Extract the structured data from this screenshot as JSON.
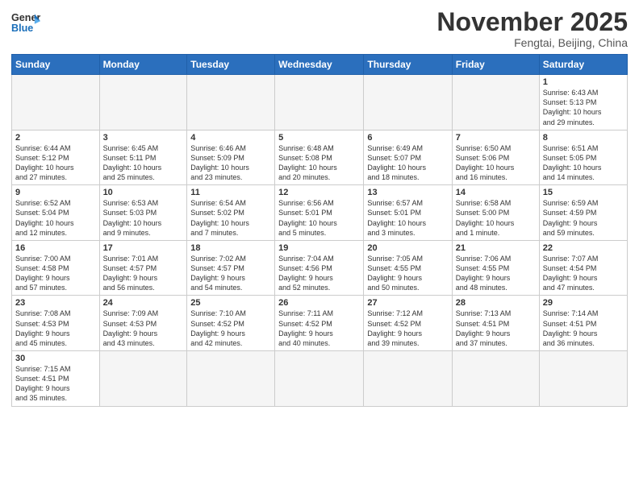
{
  "header": {
    "logo_general": "General",
    "logo_blue": "Blue",
    "month": "November 2025",
    "location": "Fengtai, Beijing, China"
  },
  "days_of_week": [
    "Sunday",
    "Monday",
    "Tuesday",
    "Wednesday",
    "Thursday",
    "Friday",
    "Saturday"
  ],
  "weeks": [
    [
      {
        "num": "",
        "info": ""
      },
      {
        "num": "",
        "info": ""
      },
      {
        "num": "",
        "info": ""
      },
      {
        "num": "",
        "info": ""
      },
      {
        "num": "",
        "info": ""
      },
      {
        "num": "",
        "info": ""
      },
      {
        "num": "1",
        "info": "Sunrise: 6:43 AM\nSunset: 5:13 PM\nDaylight: 10 hours\nand 29 minutes."
      }
    ],
    [
      {
        "num": "2",
        "info": "Sunrise: 6:44 AM\nSunset: 5:12 PM\nDaylight: 10 hours\nand 27 minutes."
      },
      {
        "num": "3",
        "info": "Sunrise: 6:45 AM\nSunset: 5:11 PM\nDaylight: 10 hours\nand 25 minutes."
      },
      {
        "num": "4",
        "info": "Sunrise: 6:46 AM\nSunset: 5:09 PM\nDaylight: 10 hours\nand 23 minutes."
      },
      {
        "num": "5",
        "info": "Sunrise: 6:48 AM\nSunset: 5:08 PM\nDaylight: 10 hours\nand 20 minutes."
      },
      {
        "num": "6",
        "info": "Sunrise: 6:49 AM\nSunset: 5:07 PM\nDaylight: 10 hours\nand 18 minutes."
      },
      {
        "num": "7",
        "info": "Sunrise: 6:50 AM\nSunset: 5:06 PM\nDaylight: 10 hours\nand 16 minutes."
      },
      {
        "num": "8",
        "info": "Sunrise: 6:51 AM\nSunset: 5:05 PM\nDaylight: 10 hours\nand 14 minutes."
      }
    ],
    [
      {
        "num": "9",
        "info": "Sunrise: 6:52 AM\nSunset: 5:04 PM\nDaylight: 10 hours\nand 12 minutes."
      },
      {
        "num": "10",
        "info": "Sunrise: 6:53 AM\nSunset: 5:03 PM\nDaylight: 10 hours\nand 9 minutes."
      },
      {
        "num": "11",
        "info": "Sunrise: 6:54 AM\nSunset: 5:02 PM\nDaylight: 10 hours\nand 7 minutes."
      },
      {
        "num": "12",
        "info": "Sunrise: 6:56 AM\nSunset: 5:01 PM\nDaylight: 10 hours\nand 5 minutes."
      },
      {
        "num": "13",
        "info": "Sunrise: 6:57 AM\nSunset: 5:01 PM\nDaylight: 10 hours\nand 3 minutes."
      },
      {
        "num": "14",
        "info": "Sunrise: 6:58 AM\nSunset: 5:00 PM\nDaylight: 10 hours\nand 1 minute."
      },
      {
        "num": "15",
        "info": "Sunrise: 6:59 AM\nSunset: 4:59 PM\nDaylight: 9 hours\nand 59 minutes."
      }
    ],
    [
      {
        "num": "16",
        "info": "Sunrise: 7:00 AM\nSunset: 4:58 PM\nDaylight: 9 hours\nand 57 minutes."
      },
      {
        "num": "17",
        "info": "Sunrise: 7:01 AM\nSunset: 4:57 PM\nDaylight: 9 hours\nand 56 minutes."
      },
      {
        "num": "18",
        "info": "Sunrise: 7:02 AM\nSunset: 4:57 PM\nDaylight: 9 hours\nand 54 minutes."
      },
      {
        "num": "19",
        "info": "Sunrise: 7:04 AM\nSunset: 4:56 PM\nDaylight: 9 hours\nand 52 minutes."
      },
      {
        "num": "20",
        "info": "Sunrise: 7:05 AM\nSunset: 4:55 PM\nDaylight: 9 hours\nand 50 minutes."
      },
      {
        "num": "21",
        "info": "Sunrise: 7:06 AM\nSunset: 4:55 PM\nDaylight: 9 hours\nand 48 minutes."
      },
      {
        "num": "22",
        "info": "Sunrise: 7:07 AM\nSunset: 4:54 PM\nDaylight: 9 hours\nand 47 minutes."
      }
    ],
    [
      {
        "num": "23",
        "info": "Sunrise: 7:08 AM\nSunset: 4:53 PM\nDaylight: 9 hours\nand 45 minutes."
      },
      {
        "num": "24",
        "info": "Sunrise: 7:09 AM\nSunset: 4:53 PM\nDaylight: 9 hours\nand 43 minutes."
      },
      {
        "num": "25",
        "info": "Sunrise: 7:10 AM\nSunset: 4:52 PM\nDaylight: 9 hours\nand 42 minutes."
      },
      {
        "num": "26",
        "info": "Sunrise: 7:11 AM\nSunset: 4:52 PM\nDaylight: 9 hours\nand 40 minutes."
      },
      {
        "num": "27",
        "info": "Sunrise: 7:12 AM\nSunset: 4:52 PM\nDaylight: 9 hours\nand 39 minutes."
      },
      {
        "num": "28",
        "info": "Sunrise: 7:13 AM\nSunset: 4:51 PM\nDaylight: 9 hours\nand 37 minutes."
      },
      {
        "num": "29",
        "info": "Sunrise: 7:14 AM\nSunset: 4:51 PM\nDaylight: 9 hours\nand 36 minutes."
      }
    ],
    [
      {
        "num": "30",
        "info": "Sunrise: 7:15 AM\nSunset: 4:51 PM\nDaylight: 9 hours\nand 35 minutes."
      },
      {
        "num": "",
        "info": ""
      },
      {
        "num": "",
        "info": ""
      },
      {
        "num": "",
        "info": ""
      },
      {
        "num": "",
        "info": ""
      },
      {
        "num": "",
        "info": ""
      },
      {
        "num": "",
        "info": ""
      }
    ]
  ]
}
